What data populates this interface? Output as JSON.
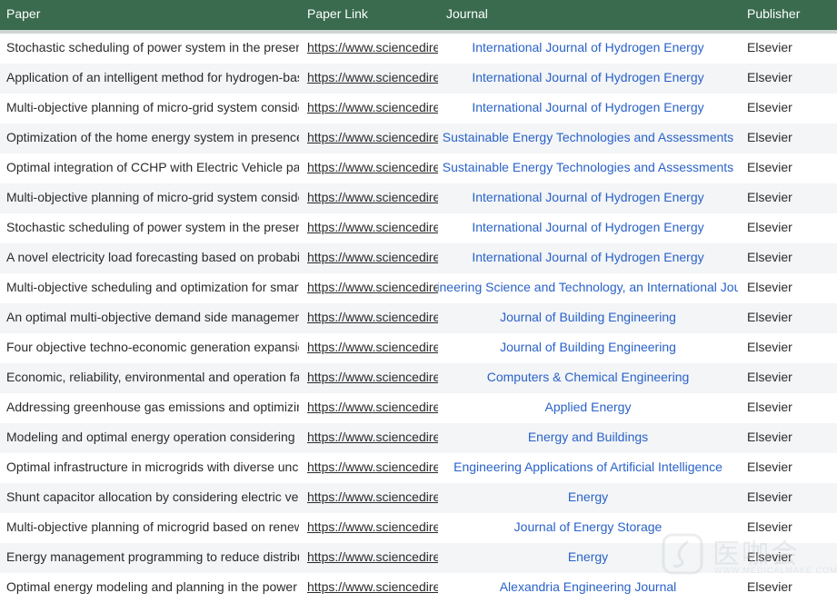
{
  "header": {
    "col_paper": "Paper",
    "col_link": "Paper Link",
    "col_journal": "Journal",
    "col_publisher": "Publisher"
  },
  "rows": [
    {
      "paper": "Stochastic scheduling of power system in the presence",
      "link": "https://www.sciencedirec",
      "journal": "International Journal of Hydrogen Energy",
      "publisher": "Elsevier"
    },
    {
      "paper": "Application of an intelligent method for hydrogen-based",
      "link": "https://www.sciencedirec",
      "journal": "International Journal of Hydrogen Energy",
      "publisher": "Elsevier"
    },
    {
      "paper": "Multi-objective planning of micro-grid system considerir",
      "link": "https://www.sciencedirec",
      "journal": "International Journal of Hydrogen Energy",
      "publisher": "Elsevier"
    },
    {
      "paper": "Optimization of the home energy system in presence of",
      "link": "https://www.sciencedirec",
      "journal": "Sustainable Energy Technologies and Assessments",
      "publisher": "Elsevier"
    },
    {
      "paper": "Optimal integration of CCHP with Electric Vehicle parki",
      "link": "https://www.sciencedirec",
      "journal": "Sustainable Energy Technologies and Assessments",
      "publisher": "Elsevier"
    },
    {
      "paper": "Multi-objective planning of micro-grid system considerir",
      "link": "https://www.sciencedirec",
      "journal": "International Journal of Hydrogen Energy",
      "publisher": "Elsevier"
    },
    {
      "paper": "Stochastic scheduling of power system in the presence",
      "link": "https://www.sciencedirec",
      "journal": "International Journal of Hydrogen Energy",
      "publisher": "Elsevier"
    },
    {
      "paper": "A novel electricity load forecasting based on probabilist",
      "link": "https://www.sciencedirec",
      "journal": "International Journal of Hydrogen Energy",
      "publisher": "Elsevier"
    },
    {
      "paper": "Multi-objective scheduling and optimization for smart er",
      "link": "https://www.sciencedirec",
      "journal": "Engineering Science and Technology, an International Journal",
      "publisher": "Elsevier"
    },
    {
      "paper": "An optimal multi-objective demand side management o",
      "link": "https://www.sciencedirec",
      "journal": "Journal of Building Engineering",
      "publisher": "Elsevier"
    },
    {
      "paper": "Four objective techno-economic generation expansion",
      "link": "https://www.sciencedirec",
      "journal": "Journal of Building Engineering",
      "publisher": "Elsevier"
    },
    {
      "paper": "Economic, reliability, environmental and operation facto",
      "link": "https://www.sciencedirec",
      "journal": "Computers & Chemical Engineering",
      "publisher": "Elsevier"
    },
    {
      "paper": "Addressing greenhouse gas emissions and optimizing p",
      "link": "https://www.sciencedirec",
      "journal": "Applied Energy",
      "publisher": "Elsevier"
    },
    {
      "paper": "Modeling and optimal energy operation considering pro",
      "link": "https://www.sciencedirec",
      "journal": "Energy and Buildings",
      "publisher": "Elsevier"
    },
    {
      "paper": "Optimal infrastructure in microgrids with diverse uncerta",
      "link": "https://www.sciencedirec",
      "journal": "Engineering Applications of Artificial Intelligence",
      "publisher": "Elsevier"
    },
    {
      "paper": "Shunt capacitor allocation by considering electric vehicl",
      "link": "https://www.sciencedirec",
      "journal": "Energy",
      "publisher": "Elsevier"
    },
    {
      "paper": "Multi-objective planning of microgrid based on renewab",
      "link": "https://www.sciencedirec",
      "journal": "Journal of Energy Storage",
      "publisher": "Elsevier"
    },
    {
      "paper": "Energy management programming to reduce distributio",
      "link": "https://www.sciencedirec",
      "journal": "Energy",
      "publisher": "Elsevier"
    },
    {
      "paper": "Optimal energy modeling and planning in the power sys",
      "link": "https://www.sciencedirec",
      "journal": "Alexandria Engineering Journal",
      "publisher": "Elsevier"
    }
  ],
  "watermark": {
    "text": "医咖会",
    "sub": "WWW.MEDICALMAKE.COM"
  },
  "colors": {
    "header_bg": "#3a6b4f",
    "header_text": "#ffffff",
    "link_blue": "#2a62c9",
    "row_alt_bg": "#f3f5f7"
  }
}
